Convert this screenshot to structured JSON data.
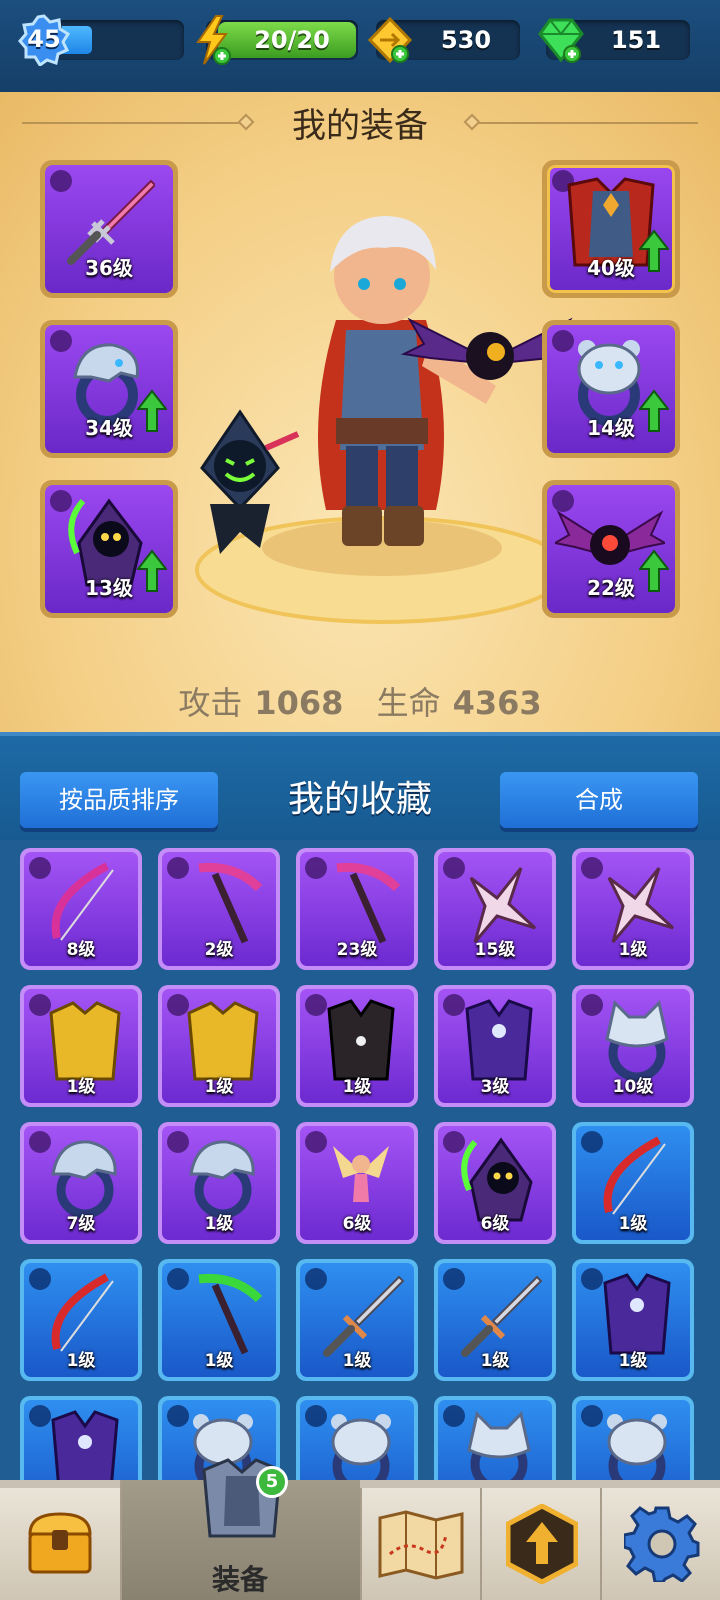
{
  "top_bar": {
    "player_level": "45",
    "xp_progress": 0.25,
    "energy": "20/20",
    "gold": "530",
    "gems": "151"
  },
  "equipment": {
    "title": "我的装备",
    "slots": [
      {
        "type": "weapon",
        "item": "sword-icon",
        "level": "36级",
        "upgrade": false
      },
      {
        "type": "armor",
        "item": "armor-icon",
        "level": "40级",
        "upgrade": true
      },
      {
        "type": "ring",
        "item": "dragon-ring-icon",
        "level": "34级",
        "upgrade": true
      },
      {
        "type": "ring",
        "item": "bear-ring-icon",
        "level": "14级",
        "upgrade": true
      },
      {
        "type": "pet",
        "item": "reaper-pet-icon",
        "level": "13级",
        "upgrade": true
      },
      {
        "type": "pet",
        "item": "bat-pet-icon",
        "level": "22级",
        "upgrade": true
      }
    ],
    "stats": {
      "attack_label": "攻击",
      "attack_value": "1068",
      "hp_label": "生命",
      "hp_value": "4363"
    }
  },
  "collection": {
    "sort_button": "按品质排序",
    "title": "我的收藏",
    "merge_button": "合成",
    "items": [
      {
        "item": "bow-icon",
        "rarity": "purple",
        "level": "8级"
      },
      {
        "item": "scythe-icon",
        "rarity": "purple",
        "level": "2级"
      },
      {
        "item": "scythe-icon",
        "rarity": "purple",
        "level": "23级"
      },
      {
        "item": "shuriken-icon",
        "rarity": "purple",
        "level": "15级"
      },
      {
        "item": "shuriken-icon",
        "rarity": "purple",
        "level": "1级"
      },
      {
        "item": "golden-armor-icon",
        "rarity": "purple",
        "level": "1级"
      },
      {
        "item": "golden-armor-icon",
        "rarity": "purple",
        "level": "1级"
      },
      {
        "item": "dark-vest-icon",
        "rarity": "purple",
        "level": "1级"
      },
      {
        "item": "moon-robe-icon",
        "rarity": "purple",
        "level": "3级"
      },
      {
        "item": "wolf-ring-icon",
        "rarity": "purple",
        "level": "10级"
      },
      {
        "item": "dragon-ring-icon",
        "rarity": "purple",
        "level": "7级"
      },
      {
        "item": "dragon-ring-icon",
        "rarity": "purple",
        "level": "1级"
      },
      {
        "item": "fairy-pet-icon",
        "rarity": "purple",
        "level": "6级"
      },
      {
        "item": "reaper-pet-icon",
        "rarity": "purple",
        "level": "6级"
      },
      {
        "item": "bow-icon",
        "rarity": "blue",
        "level": "1级"
      },
      {
        "item": "bow-icon",
        "rarity": "blue",
        "level": "1级"
      },
      {
        "item": "scythe-icon",
        "rarity": "blue",
        "level": "1级"
      },
      {
        "item": "sword-icon",
        "rarity": "blue",
        "level": "1级"
      },
      {
        "item": "sword-icon",
        "rarity": "blue",
        "level": "1级"
      },
      {
        "item": "moon-robe-icon",
        "rarity": "blue",
        "level": "1级"
      },
      {
        "item": "moon-robe-icon",
        "rarity": "blue",
        "level": ""
      },
      {
        "item": "bear-ring-icon",
        "rarity": "blue",
        "level": ""
      },
      {
        "item": "bear-ring-icon",
        "rarity": "blue",
        "level": ""
      },
      {
        "item": "wolf-ring-icon",
        "rarity": "blue",
        "level": ""
      },
      {
        "item": "bear-ring-icon",
        "rarity": "blue",
        "level": ""
      }
    ]
  },
  "bottom_nav": {
    "items": [
      {
        "icon": "treasure-chest-icon",
        "label": ""
      },
      {
        "icon": "armor-nav-icon",
        "label": "装备",
        "badge": "5"
      },
      {
        "icon": "map-icon",
        "label": ""
      },
      {
        "icon": "upgrade-icon",
        "label": ""
      },
      {
        "icon": "settings-gear-icon",
        "label": ""
      }
    ]
  },
  "colors": {
    "purple_rarity": "#8a3ee6",
    "blue_rarity": "#2a7ee6",
    "panel_gold": "#f4cf86",
    "upgrade_green": "#3cc83c"
  }
}
